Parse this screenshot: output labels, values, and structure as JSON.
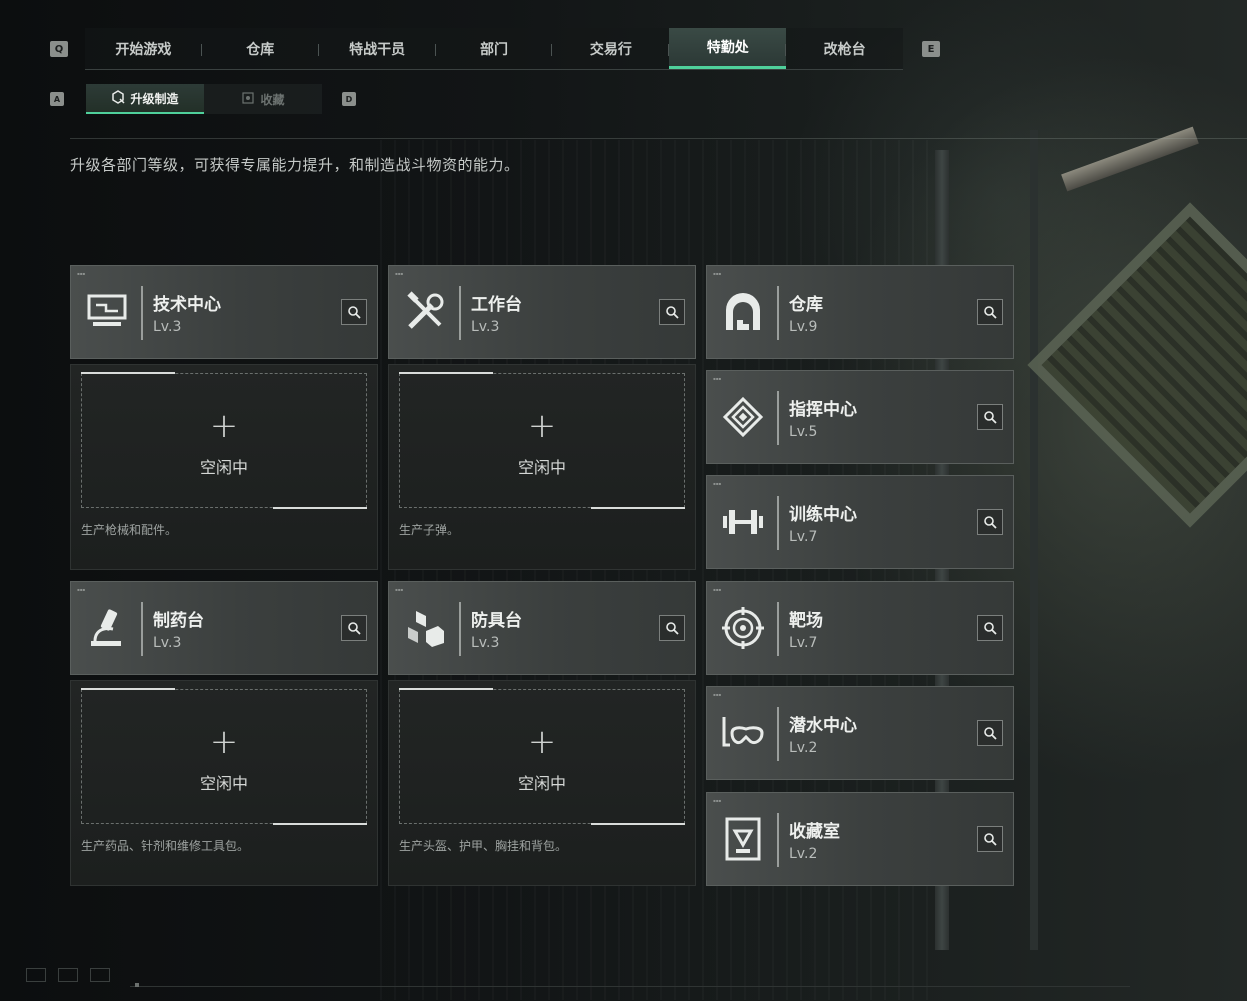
{
  "top_tabs": {
    "key_left": "Q",
    "key_right": "E",
    "items": [
      {
        "label": "开始游戏"
      },
      {
        "label": "仓库"
      },
      {
        "label": "特战干员"
      },
      {
        "label": "部门"
      },
      {
        "label": "交易行"
      },
      {
        "label": "特勤处",
        "active": true
      },
      {
        "label": "改枪台"
      }
    ]
  },
  "sub_tabs": {
    "key_left": "A",
    "key_right": "D",
    "items": [
      {
        "label": "升级制造",
        "icon": "upgrade-craft-icon",
        "active": true
      },
      {
        "label": "收藏",
        "icon": "collection-icon",
        "active": false
      }
    ]
  },
  "description": "升级各部门等级，可获得专属能力提升，和制造战斗物资的能力。",
  "colors": {
    "accent": "#4fd09b"
  },
  "production": [
    {
      "name": "技术中心",
      "level": "Lv.3",
      "icon": "computer-icon",
      "slot_plus": "+",
      "slot_status": "空闲中",
      "slot_desc": "生产枪械和配件。"
    },
    {
      "name": "工作台",
      "level": "Lv.3",
      "icon": "tools-icon",
      "slot_plus": "+",
      "slot_status": "空闲中",
      "slot_desc": "生产子弹。"
    },
    {
      "name": "制药台",
      "level": "Lv.3",
      "icon": "microscope-icon",
      "slot_plus": "+",
      "slot_status": "空闲中",
      "slot_desc": "生产药品、针剂和维修工具包。"
    },
    {
      "name": "防具台",
      "level": "Lv.3",
      "icon": "armor-boxes-icon",
      "slot_plus": "+",
      "slot_status": "空闲中",
      "slot_desc": "生产头盔、护甲、胸挂和背包。"
    }
  ],
  "facilities": [
    {
      "name": "仓库",
      "level": "Lv.9",
      "icon": "warehouse-icon"
    },
    {
      "name": "指挥中心",
      "level": "Lv.5",
      "icon": "command-chip-icon"
    },
    {
      "name": "训练中心",
      "level": "Lv.7",
      "icon": "dumbbell-icon"
    },
    {
      "name": "靶场",
      "level": "Lv.7",
      "icon": "target-icon"
    },
    {
      "name": "潜水中心",
      "level": "Lv.2",
      "icon": "diving-mask-icon"
    },
    {
      "name": "收藏室",
      "level": "Lv.2",
      "icon": "collection-room-icon"
    }
  ]
}
